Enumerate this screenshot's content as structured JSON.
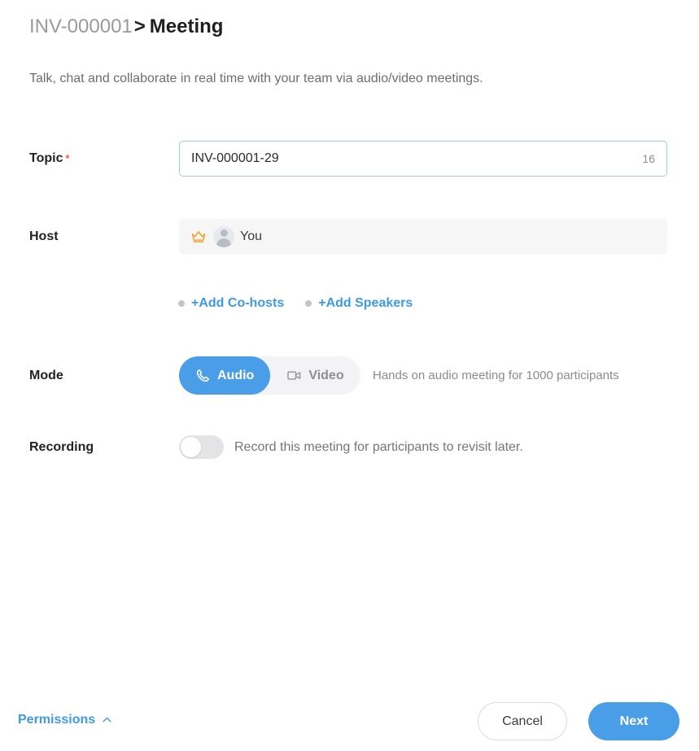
{
  "header": {
    "breadcrumb_parent": "INV-000001",
    "breadcrumb_separator": ">",
    "breadcrumb_current": "Meeting",
    "description": "Talk, chat and collaborate in real time with your team via audio/video meetings."
  },
  "form": {
    "topic": {
      "label": "Topic",
      "required_marker": "*",
      "value": "INV-000001-29",
      "placeholder": "Topic",
      "char_count": "16"
    },
    "host": {
      "label": "Host",
      "name": "You",
      "crown_icon": "crown-icon",
      "avatar_icon": "avatar-placeholder"
    },
    "add_links": [
      {
        "label": "+Add Co-hosts",
        "name": "add-co-hosts"
      },
      {
        "label": "+Add Speakers",
        "name": "add-speakers"
      }
    ],
    "mode": {
      "label": "Mode",
      "options": [
        {
          "label": "Audio",
          "icon": "phone-icon",
          "selected": true
        },
        {
          "label": "Video",
          "icon": "video-camera-icon",
          "selected": false
        }
      ],
      "hint": "Hands on audio meeting for 1000 participants"
    },
    "recording": {
      "label": "Recording",
      "enabled": false,
      "hint": "Record this meeting for participants to revisit later."
    }
  },
  "footer": {
    "permissions_label": "Permissions",
    "permissions_icon": "chevron-up-icon",
    "cancel_label": "Cancel",
    "next_label": "Next"
  },
  "colors": {
    "accent_blue": "#4a9ee8",
    "link_blue": "#3d9ae8",
    "required_red": "#f05a5a",
    "crown_orange": "#f5a431",
    "input_border": "#9fccef",
    "field_bg": "#f6f6f7"
  }
}
